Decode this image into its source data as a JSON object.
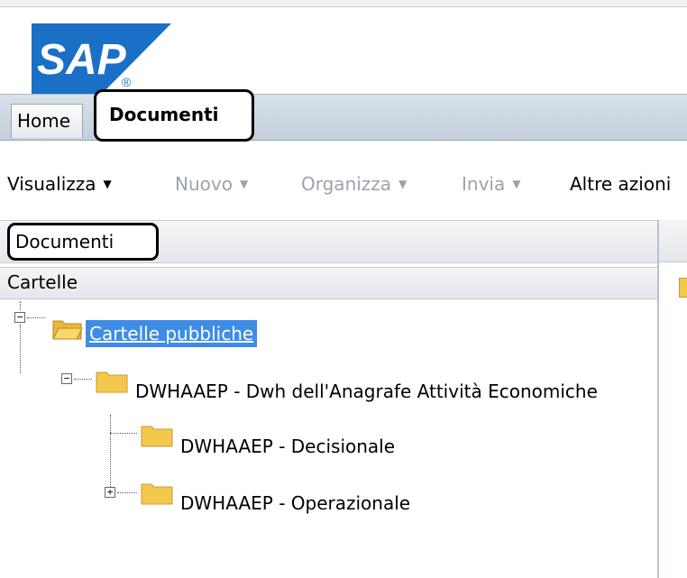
{
  "brand": {
    "logo_text": "SAP",
    "registered_mark": "®",
    "logo_color": "#1a6fc7"
  },
  "tabs": [
    {
      "label": "Home",
      "active": false
    },
    {
      "label": "Documenti",
      "active": true
    }
  ],
  "toolbar": {
    "items": [
      {
        "label": "Visualizza",
        "enabled": true,
        "has_menu": true
      },
      {
        "label": "Nuovo",
        "enabled": false,
        "has_menu": true
      },
      {
        "label": "Organizza",
        "enabled": false,
        "has_menu": true
      },
      {
        "label": "Invia",
        "enabled": false,
        "has_menu": true
      },
      {
        "label": "Altre azioni",
        "enabled": true,
        "has_menu": false
      }
    ],
    "caret_glyph": "▼"
  },
  "left_panel": {
    "section_title": "Documenti",
    "subsection_title": "Cartelle"
  },
  "tree": {
    "root": {
      "label": "Cartelle pubbliche",
      "expanded": true,
      "selected": true,
      "icon": "open-folder-icon"
    },
    "children": [
      {
        "label": "DWHAAEP - Dwh dell'Anagrafe Attività Economiche",
        "expanded": true,
        "icon": "folder-icon",
        "children": [
          {
            "label": "DWHAAEP - Decisionale",
            "expanded": false,
            "has_children": false,
            "icon": "folder-icon"
          },
          {
            "label": "DWHAAEP - Operazionale",
            "expanded": false,
            "has_children": true,
            "icon": "folder-icon"
          }
        ]
      }
    ],
    "expander_minus": "−",
    "expander_plus": "+"
  },
  "colors": {
    "selection": "#3d8de6",
    "folder": "#f2c94c",
    "tab_bar": "#c9d3de"
  }
}
